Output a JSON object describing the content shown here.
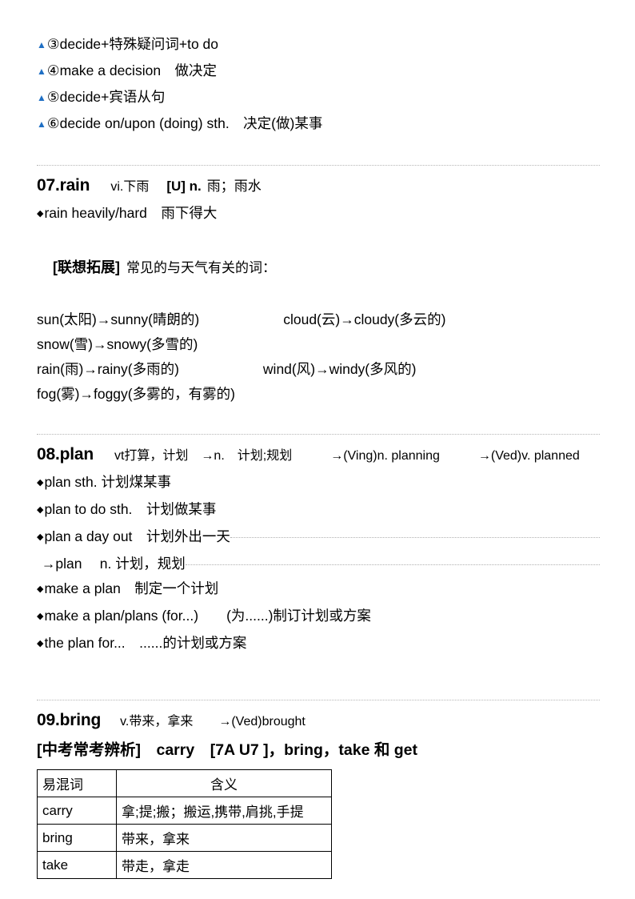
{
  "decide_items": [
    {
      "marker": "▲",
      "num": "③",
      "text": "decide+特殊疑问词+to do"
    },
    {
      "marker": "▲",
      "num": "④",
      "text": "make a decision　做决定"
    },
    {
      "marker": "▲",
      "num": "⑤",
      "text": "decide+宾语从句"
    },
    {
      "marker": "▲",
      "num": "⑥",
      "text": "decide on/upon (doing) sth.　决定(做)某事"
    }
  ],
  "entry_rain": {
    "number": "07.rain",
    "pos": "vi.下雨",
    "bold_part": "[U] n.",
    "plain_part": "雨；雨水",
    "phrases": [
      {
        "marker": "◆",
        "text": "rain heavily/hard　雨下得大"
      }
    ],
    "tag_label": "[联想拓展]",
    "tag_text": "常见的与天气有关的词：",
    "weather_lines": [
      "sun(太阳)→sunny(晴朗的)　　　　　　cloud(云)→cloudy(多云的)　　　　　　snow(雪)→snowy(多雪的)",
      "rain(雨)→rainy(多雨的)　　　　　　wind(风)→windy(多风的)",
      "fog(雾)→foggy(多雾的，有雾的)"
    ]
  },
  "entry_plan": {
    "number": "08.plan",
    "pos": "vt打算，计划　→n.　计划;规划　　　→(Ving)n. planning　　　→(Ved)v. planned",
    "phrases": [
      {
        "marker": "◆",
        "text": "plan sth. 计划煤某事",
        "underline": false
      },
      {
        "marker": "◆",
        "text": "plan to do sth.　计划做某事",
        "underline": false
      },
      {
        "marker": "◆",
        "text": "plan a day out　计划外出一天",
        "underline": true
      },
      {
        "marker": "",
        "text": " →plan　 n. 计划，规划",
        "underline": true
      },
      {
        "marker": "◆",
        "text": "make a plan　制定一个计划",
        "underline": false
      },
      {
        "marker": "◆",
        "text": "make a plan/plans (for...)　　(为......)制订计划或方案",
        "underline": false
      },
      {
        "marker": "◆",
        "text": "the plan for...　......的计划或方案",
        "underline": false
      }
    ]
  },
  "entry_bring": {
    "number": "09.bring",
    "pos": "v.带来，拿来　　→(Ved)brought",
    "analysis_heading": "[中考常考辨析]　carry　[7A U7 ]，bring，take 和 get",
    "table": {
      "headers": [
        "易混词",
        "含义"
      ],
      "rows": [
        [
          "carry",
          "拿;提;搬；搬运,携带,肩挑,手提"
        ],
        [
          "bring",
          "带来，拿来"
        ],
        [
          "take",
          "带走，拿走"
        ]
      ]
    }
  },
  "separators": 3
}
